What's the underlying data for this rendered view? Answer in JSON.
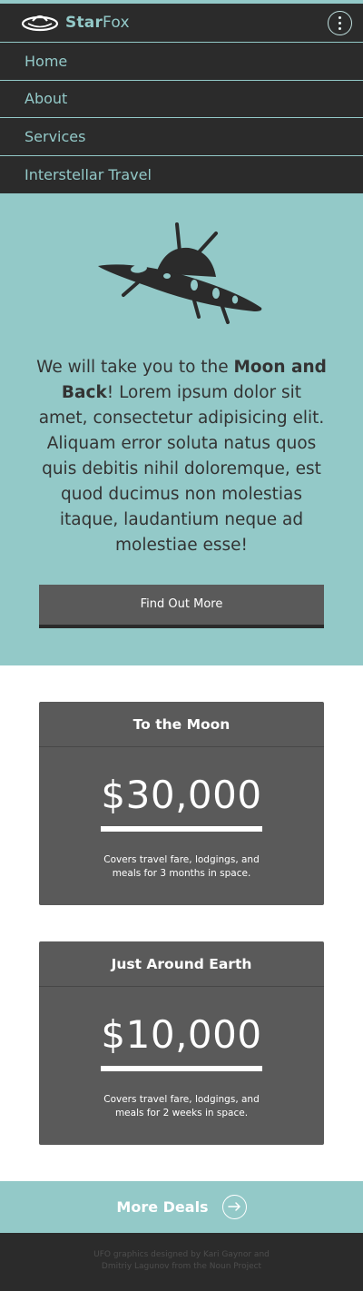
{
  "brand": {
    "bold": "Star",
    "light": "Fox"
  },
  "icons": {
    "logo": "ufo-outline-icon",
    "menu": "kebab-menu-icon",
    "hero": "ufo-icon",
    "more": "arrow-right-circle-icon"
  },
  "nav": {
    "items": [
      {
        "label": "Home"
      },
      {
        "label": "About"
      },
      {
        "label": "Services"
      },
      {
        "label": "Interstellar Travel"
      }
    ]
  },
  "hero": {
    "text_before": "We will take you to the ",
    "text_bold": "Moon and Back",
    "text_after": "! Lorem ipsum dolor sit amet, consectetur adipisicing elit. Aliquam error soluta natus quos quis debitis nihil doloremque, est quod ducimus non molestias itaque, laudantium neque ad molestiae esse!",
    "cta_label": "Find Out More"
  },
  "deals": [
    {
      "title": "To the Moon",
      "price": "$30,000",
      "description": "Covers travel fare, lodgings, and meals for 3 months in space."
    },
    {
      "title": "Just Around Earth",
      "price": "$10,000",
      "description": "Covers travel fare, lodgings, and meals for 2 weeks in space."
    }
  ],
  "more_deals": {
    "label": "More Deals"
  },
  "footer": {
    "text": "UFO graphics designed by Kari Gaynor and Dmitriy Lagunov from the Noun Project"
  },
  "colors": {
    "accent": "#93c9c8",
    "dark": "#2b2b2b",
    "card": "#5a5a5a",
    "text": "#333333"
  }
}
